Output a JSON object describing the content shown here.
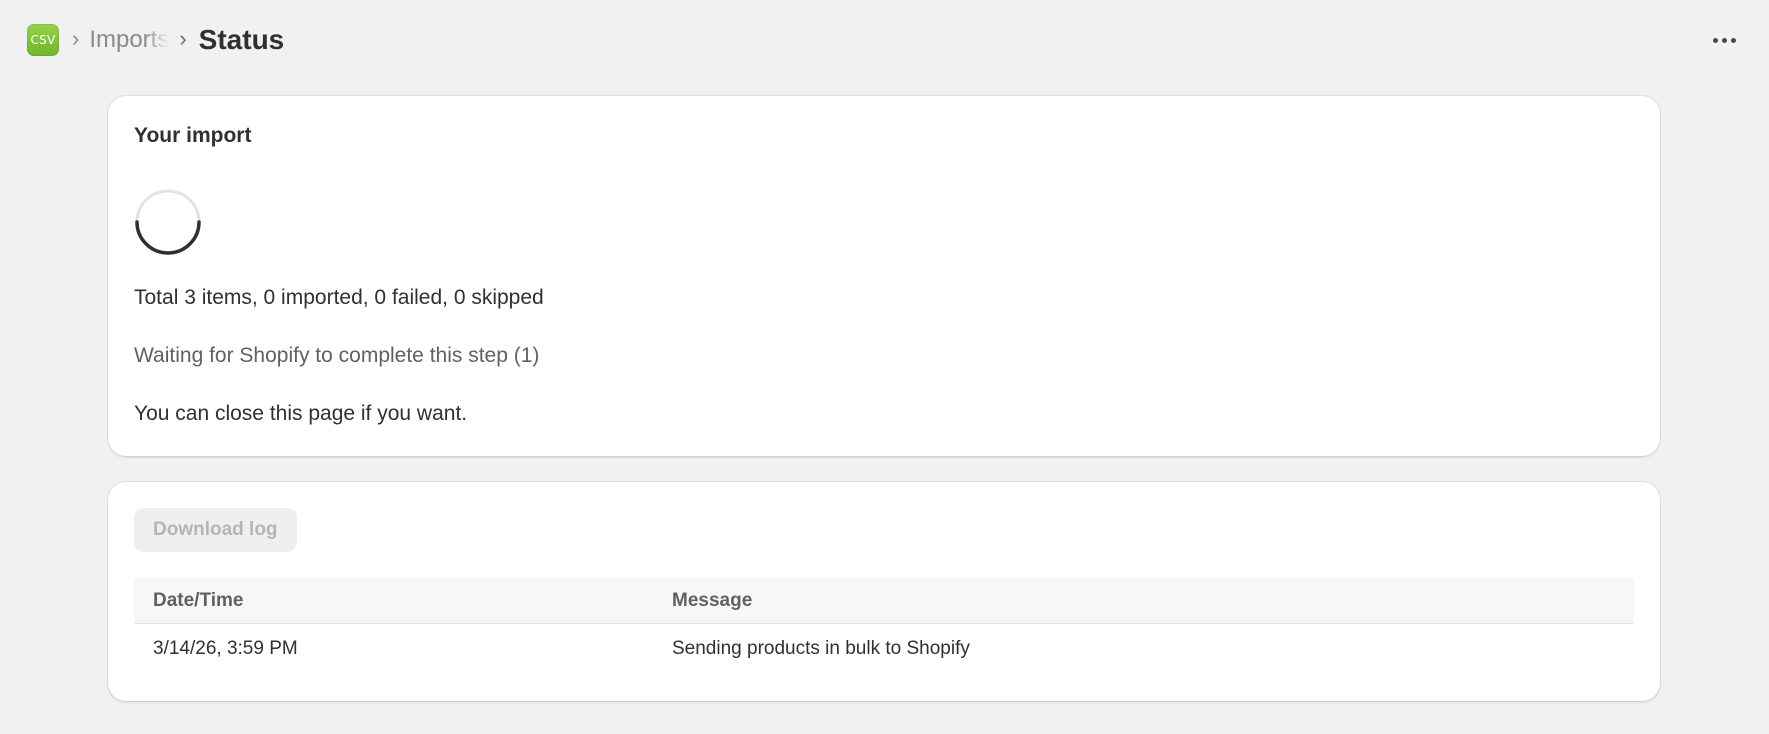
{
  "header": {
    "app_icon_text": "CSV",
    "breadcrumb_parent": "Imports",
    "title": "Status",
    "more_icon": "more-horizontal-icon"
  },
  "status_card": {
    "title": "Your import",
    "spinner": "loading-spinner",
    "total_line": "Total 3 items, 0 imported, 0 failed, 0 skipped",
    "waiting_line": "Waiting for Shopify to complete this step (1)",
    "close_line": "You can close this page if you want."
  },
  "log_card": {
    "download_label": "Download log",
    "download_enabled": false,
    "columns": [
      "Date/Time",
      "Message"
    ],
    "rows": [
      {
        "datetime": "3/14/26, 3:59 PM",
        "message": "Sending products in bulk to Shopify"
      }
    ]
  },
  "colors": {
    "page_bg": "#f1f1f1",
    "card_bg": "#ffffff",
    "app_icon_green": "#7cc236",
    "text_primary": "#303030",
    "text_secondary": "#616161"
  }
}
